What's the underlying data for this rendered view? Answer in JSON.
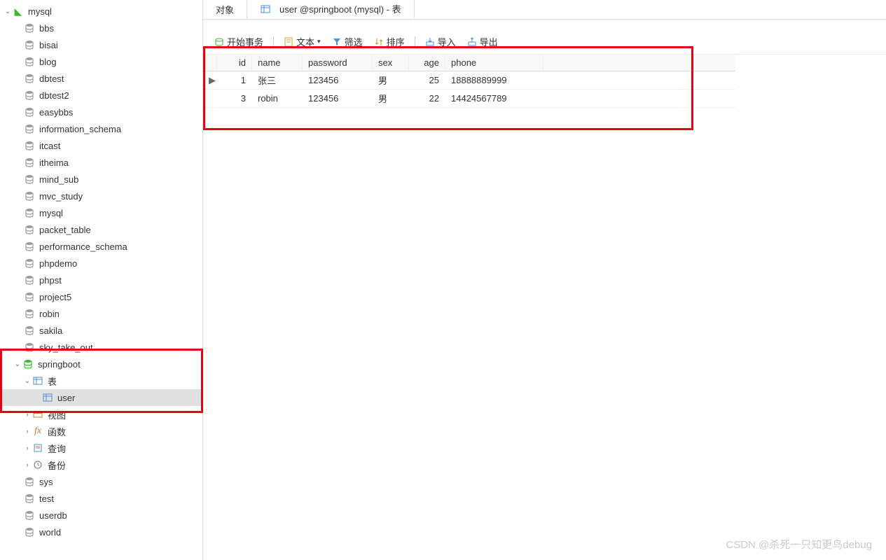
{
  "sidebar": {
    "connection": "mysql",
    "databases": [
      "bbs",
      "bisai",
      "blog",
      "dbtest",
      "dbtest2",
      "easybbs",
      "information_schema",
      "itcast",
      "itheima",
      "mind_sub",
      "mvc_study",
      "mysql",
      "packet_table",
      "performance_schema",
      "phpdemo",
      "phpst",
      "project5",
      "robin",
      "sakila",
      "sky_take_out"
    ],
    "active_db": "springboot",
    "nodes": {
      "tables": "表",
      "user": "user",
      "views": "视图",
      "functions": "函数",
      "queries": "查询",
      "backups": "备份"
    },
    "tail_databases": [
      "sys",
      "test",
      "userdb",
      "world"
    ]
  },
  "tabs": {
    "objects": "对象",
    "active": "user @springboot (mysql) - 表"
  },
  "toolbar": {
    "begin_tx": "开始事务",
    "text": "文本",
    "filter": "筛选",
    "sort": "排序",
    "import": "导入",
    "export": "导出"
  },
  "grid": {
    "headers": [
      "id",
      "name",
      "password",
      "sex",
      "age",
      "phone"
    ],
    "rows": [
      {
        "marker": "▶",
        "id": "1",
        "name": "张三",
        "password": "123456",
        "sex": "男",
        "age": "25",
        "phone": "18888889999"
      },
      {
        "marker": "",
        "id": "3",
        "name": "robin",
        "password": "123456",
        "sex": "男",
        "age": "22",
        "phone": "14424567789"
      }
    ]
  },
  "watermark": "CSDN @杀死一只知更鸟debug"
}
